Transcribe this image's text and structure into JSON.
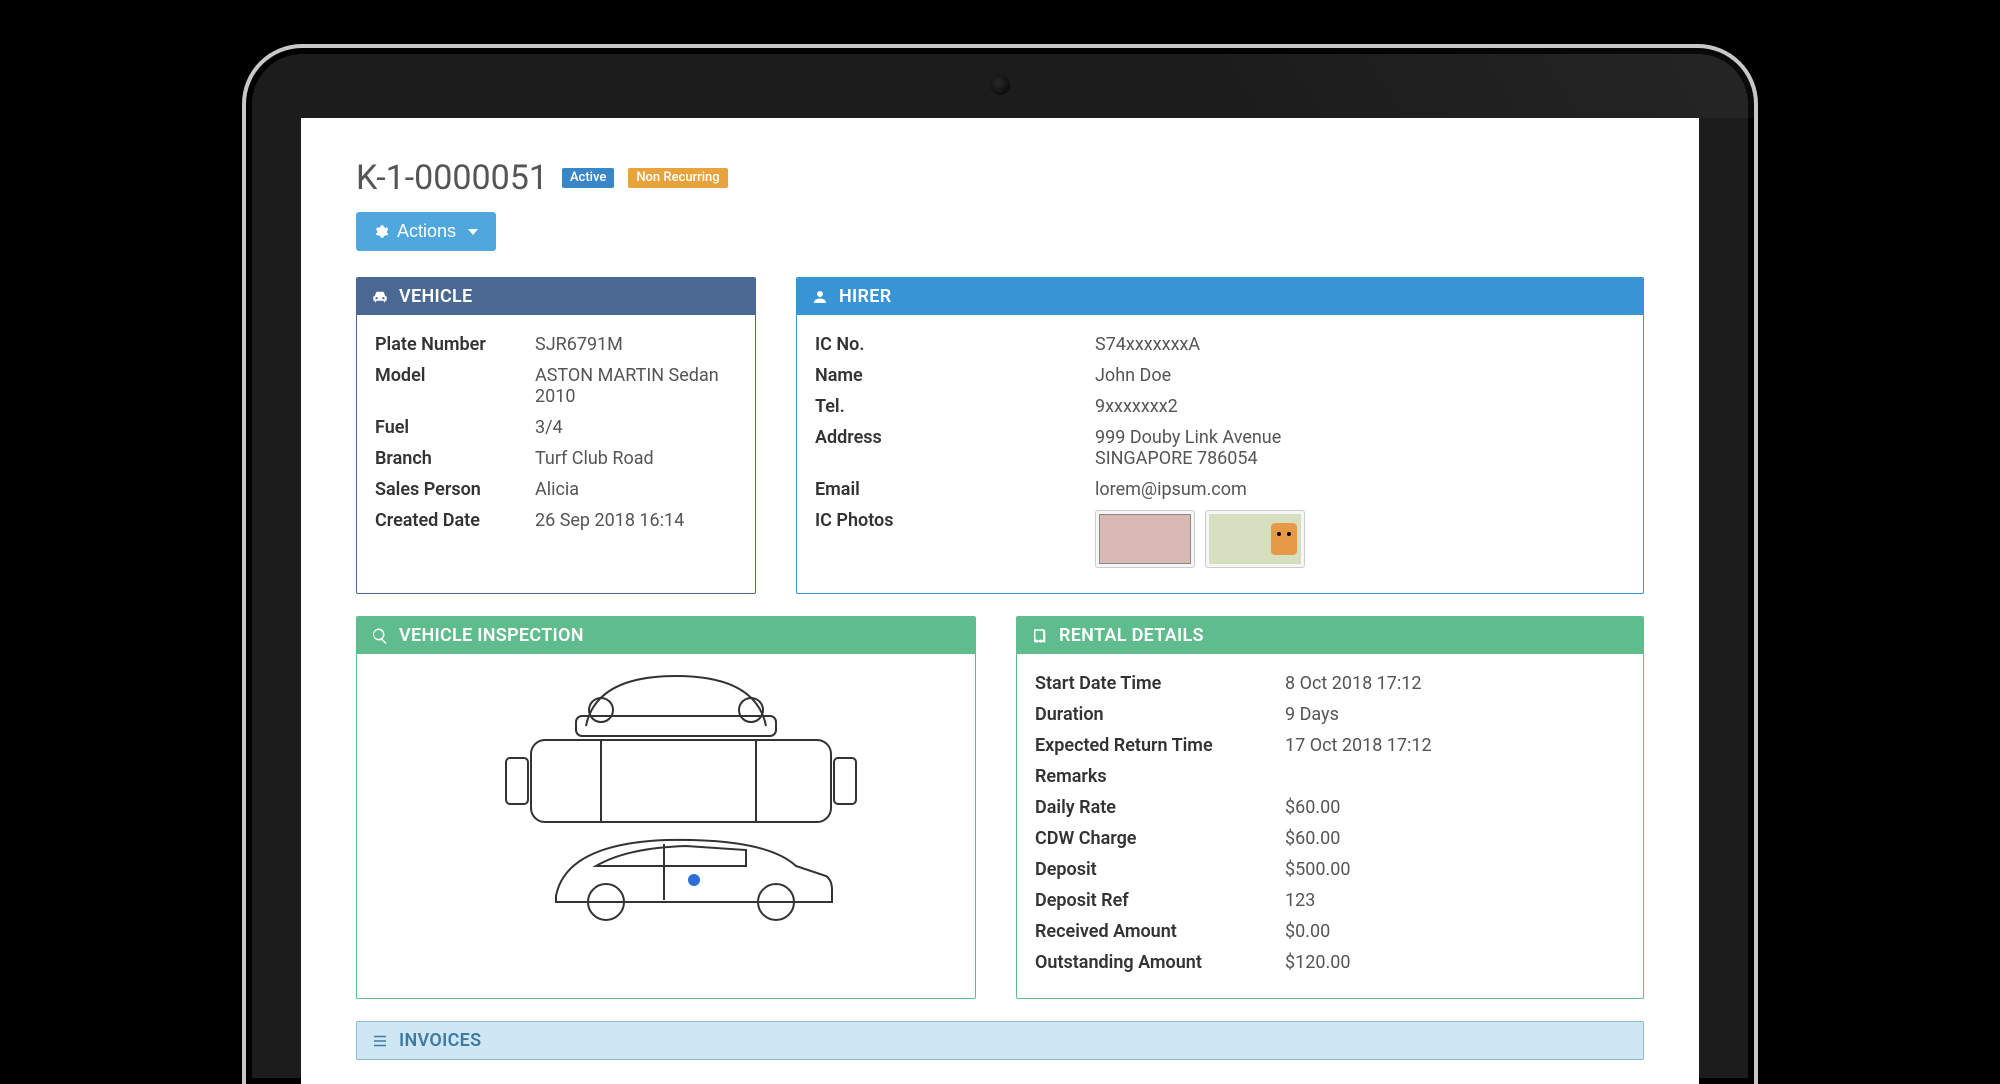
{
  "header": {
    "record_id": "K-1-0000051",
    "badge_active": "Active",
    "badge_recurring": "Non Recurring",
    "actions_label": "Actions"
  },
  "vehicle": {
    "panel_title": "Vehicle",
    "labels": {
      "plate": "Plate Number",
      "model": "Model",
      "fuel": "Fuel",
      "branch": "Branch",
      "sales": "Sales Person",
      "created": "Created Date"
    },
    "plate": "SJR6791M",
    "model": "ASTON MARTIN Sedan 2010",
    "fuel": "3/4",
    "branch": "Turf Club Road",
    "sales": "Alicia",
    "created": "26 Sep 2018 16:14"
  },
  "hirer": {
    "panel_title": "Hirer",
    "labels": {
      "ic": "IC No.",
      "name": "Name",
      "tel": "Tel.",
      "address": "Address",
      "email": "Email",
      "photos": "IC Photos"
    },
    "ic": "S74xxxxxxxA",
    "name": "John Doe",
    "tel": "9xxxxxxx2",
    "address1": "999 Douby Link Avenue",
    "address2": "SINGAPORE 786054",
    "email": "lorem@ipsum.com"
  },
  "inspection": {
    "panel_title": "Vehicle Inspection"
  },
  "rental": {
    "panel_title": "Rental Details",
    "labels": {
      "start": "Start Date Time",
      "duration": "Duration",
      "expected": "Expected Return Time",
      "remarks": "Remarks",
      "daily": "Daily Rate",
      "cdw": "CDW Charge",
      "deposit": "Deposit",
      "depref": "Deposit Ref",
      "received": "Received Amount",
      "outstanding": "Outstanding Amount"
    },
    "start": "8 Oct 2018 17:12",
    "duration": "9 Days",
    "expected": "17 Oct 2018 17:12",
    "remarks": "",
    "daily": "$60.00",
    "cdw": "$60.00",
    "deposit": "$500.00",
    "depref": "123",
    "received": "$0.00",
    "outstanding": "$120.00"
  },
  "invoices": {
    "panel_title": "Invoices"
  }
}
